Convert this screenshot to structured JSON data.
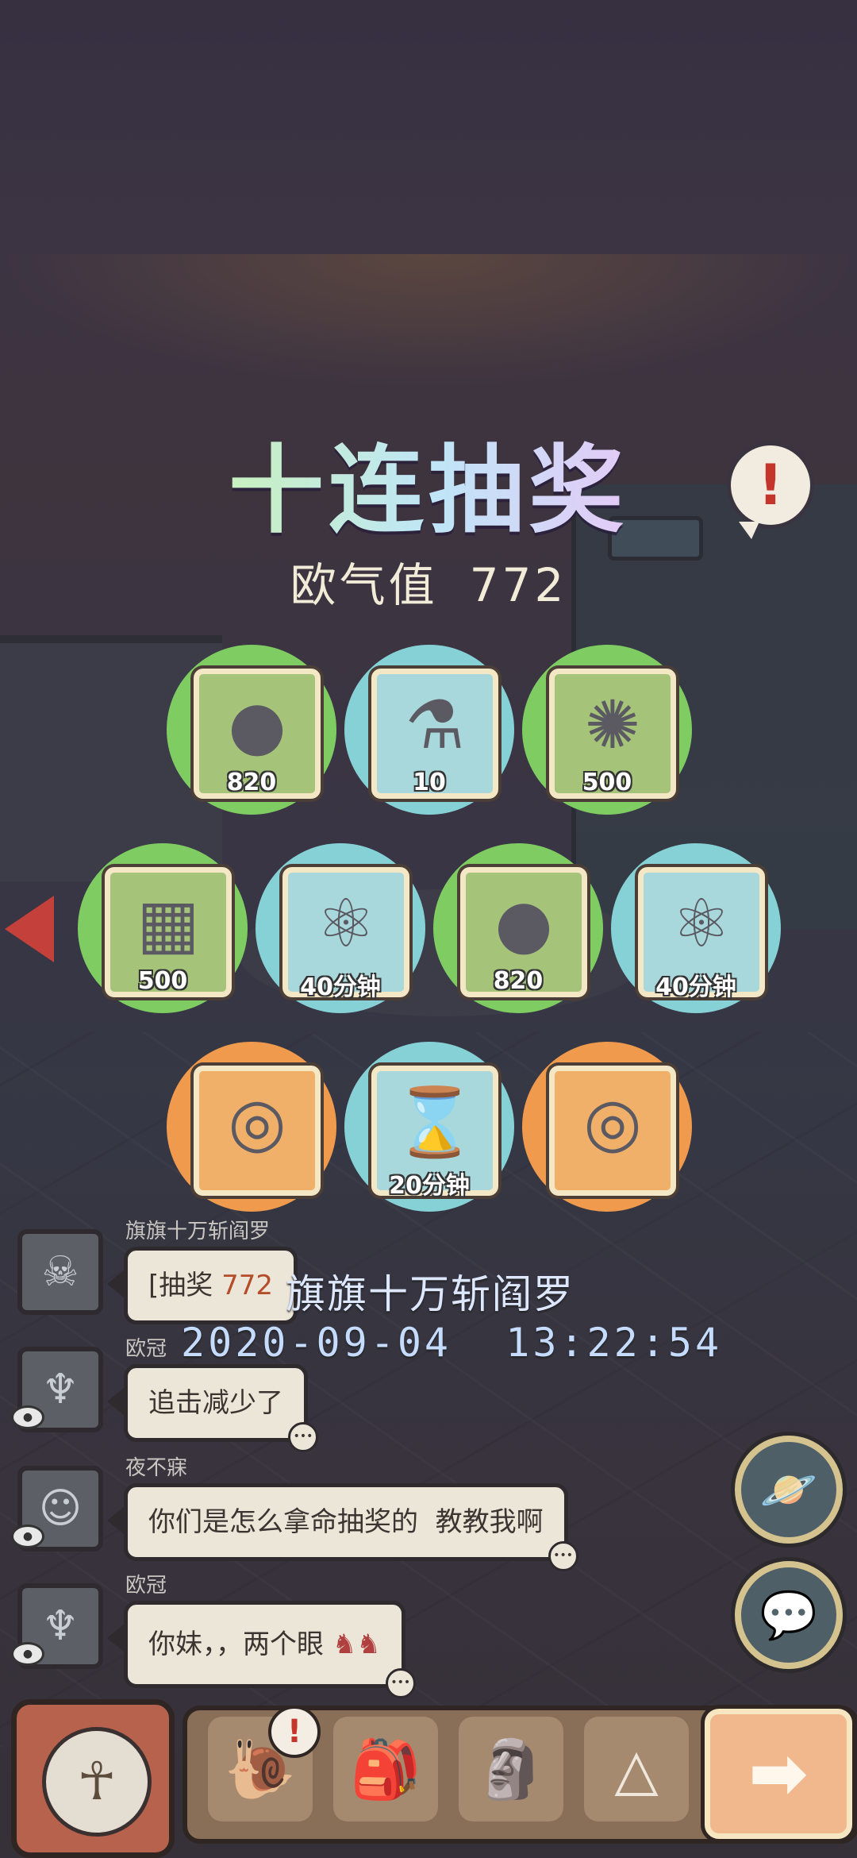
{
  "title": "十连抽奖",
  "luck": {
    "label": "欧气值",
    "value": "772"
  },
  "prizes": [
    {
      "icon": "tadpole-icon",
      "glyph": "●",
      "qty": "820",
      "color": "green"
    },
    {
      "icon": "potion-bottle-icon",
      "glyph": "⚗",
      "qty": "10",
      "color": "blue"
    },
    {
      "icon": "cell-virus-icon",
      "glyph": "✺",
      "qty": "500",
      "color": "green"
    },
    {
      "icon": "map-scroll-icon",
      "glyph": "▦",
      "qty": "500",
      "color": "green"
    },
    {
      "icon": "lab-flask-icon",
      "glyph": "⚛",
      "qty": "40分钟",
      "color": "blue"
    },
    {
      "icon": "tadpole-icon",
      "glyph": "●",
      "qty": "820",
      "color": "green"
    },
    {
      "icon": "lab-flask-icon",
      "glyph": "⚛",
      "qty": "40分钟",
      "color": "blue"
    },
    {
      "icon": "ring-icon",
      "glyph": "◎",
      "qty": "",
      "color": "orange"
    },
    {
      "icon": "hourglass-icon",
      "glyph": "⌛",
      "qty": "20分钟",
      "color": "blue"
    },
    {
      "icon": "ring-icon",
      "glyph": "◎",
      "qty": "",
      "color": "orange"
    }
  ],
  "chat": [
    {
      "user": "旗旗十万斩阎罗",
      "message_prefix": "[抽奖 ",
      "message_value": "772",
      "avatar": "skull-mask-icon"
    },
    {
      "user": "欧冠",
      "message": "追击减少了",
      "avatar": "shell-fan-icon"
    },
    {
      "user": "夜不寐",
      "message": "你们是怎么拿命抽奖的  教教我啊",
      "avatar": "anime-girl-icon"
    },
    {
      "user": "欧冠",
      "message": "你妹，，两个眼",
      "avatar": "shell-fan-icon"
    }
  ],
  "overlay": {
    "name": "旗旗十万斩阎罗",
    "time": "2020-09-04  13:22:54"
  },
  "buttons": {
    "planet": "planet-icon",
    "chat": "chat-bubble-icon"
  },
  "bottom": {
    "next_glyph": "➡",
    "badge": "!"
  }
}
